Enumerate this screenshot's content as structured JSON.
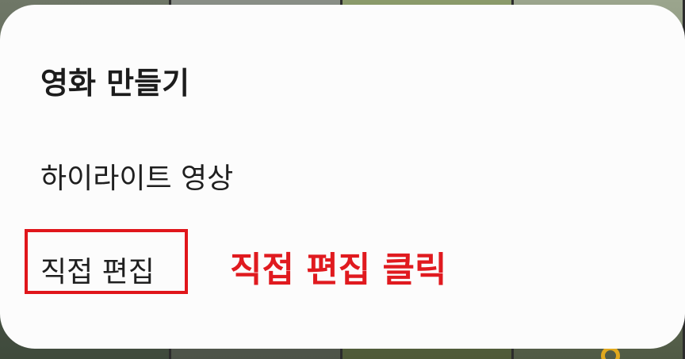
{
  "sheet": {
    "title": "영화 만들기",
    "items": [
      {
        "label": "하이라이트 영상"
      },
      {
        "label": "직접 편집"
      }
    ]
  },
  "annotation": {
    "text": "직접 편집 클릭",
    "color": "#e01a1f"
  },
  "colors": {
    "sheet_background": "#fcfcfc",
    "highlight_box": "#e0161b"
  }
}
